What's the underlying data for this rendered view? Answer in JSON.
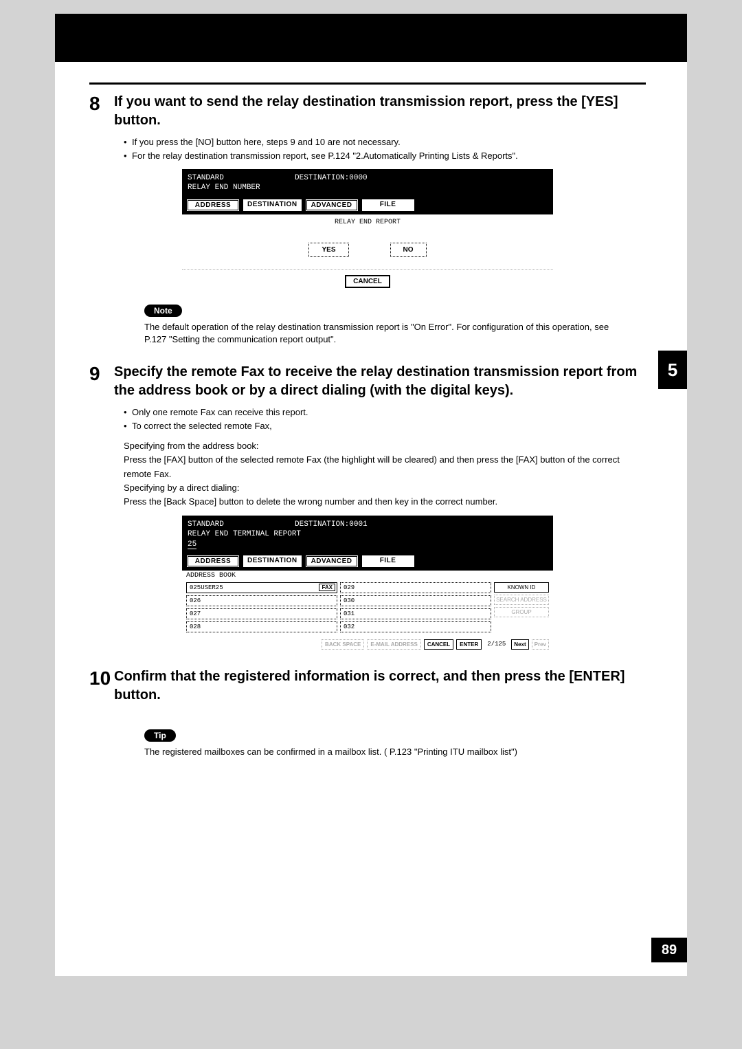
{
  "chapter": "5",
  "page_number": "89",
  "step8": {
    "num": "8",
    "title": "If you want to send the relay destination transmission report, press the [YES] button.",
    "bullets": [
      "If you press the [NO] button here, steps 9 and 10 are not necessary.",
      "For the relay destination transmission report, see  P.124 \"2.Automatically Printing Lists & Reports\"."
    ]
  },
  "screenshot1": {
    "header_left": "STANDARD",
    "header_right": "DESTINATION:0000",
    "subheader": "RELAY END NUMBER",
    "tabs": [
      "ADDRESS",
      "DESTINATION",
      "ADVANCED",
      "FILE"
    ],
    "body_label": "RELAY END REPORT",
    "yes": "YES",
    "no": "NO",
    "cancel": "CANCEL"
  },
  "note": {
    "label": "Note",
    "text": "The default operation of the relay destination transmission report is \"On Error\". For configuration of this operation, see  P.127 \"Setting the communication report output\"."
  },
  "step9": {
    "num": "9",
    "title": "Specify the remote Fax to receive the relay destination transmission report from the address book or by a direct dialing (with the digital keys).",
    "bullets": [
      "Only one remote Fax can receive this report.",
      "To correct the selected remote Fax,"
    ],
    "sub1_title": "Specifying from the address book:",
    "sub1_text": "Press the [FAX] button of the selected remote Fax (the highlight will be cleared) and then press the [FAX] button of the correct remote Fax.",
    "sub2_title": "Specifying by a direct dialing:",
    "sub2_text": "Press the [Back Space] button to delete the wrong number and then key in the correct number."
  },
  "screenshot2": {
    "header_left": "STANDARD",
    "header_right": "DESTINATION:0001",
    "subheader": "RELAY END TERMINAL REPORT",
    "number": "25",
    "tabs": [
      "ADDRESS",
      "DESTINATION",
      "ADVANCED",
      "FILE"
    ],
    "section_label": "ADDRESS BOOK",
    "col1": [
      {
        "id": "025",
        "name": "USER25",
        "fax": "FAX"
      },
      {
        "id": "026",
        "name": ""
      },
      {
        "id": "027",
        "name": ""
      },
      {
        "id": "028",
        "name": ""
      }
    ],
    "col2": [
      {
        "id": "029"
      },
      {
        "id": "030"
      },
      {
        "id": "031"
      },
      {
        "id": "032"
      }
    ],
    "side_buttons": [
      "KNOWN ID",
      "SEARCH ADDRESS",
      "GROUP"
    ],
    "bottom": {
      "backspace": "BACK SPACE",
      "email": "E-MAIL ADDRESS",
      "cancel": "CANCEL",
      "enter": "ENTER",
      "pager": "2/125",
      "next": "Next",
      "prev": "Prev"
    }
  },
  "step10": {
    "num": "10",
    "title": "Confirm that the registered information is correct, and then press the [ENTER] button."
  },
  "tip": {
    "label": "Tip",
    "text": "The registered mailboxes can be confirmed in a mailbox list. ( P.123 \"Printing ITU mailbox list\")"
  }
}
